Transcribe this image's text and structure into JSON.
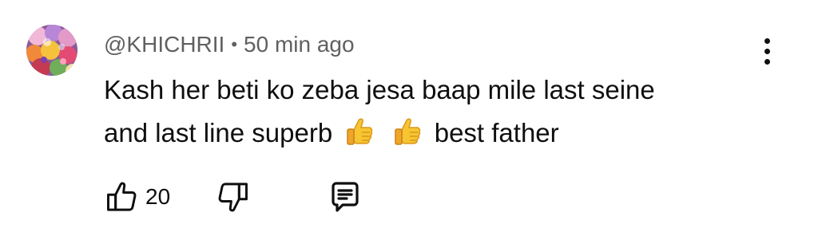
{
  "comment": {
    "author": "@KHICHRII",
    "separator": "•",
    "time": "50 min ago",
    "text_line1": "Kash her beti ko zeba jesa baap mile last seine",
    "text_line2_before": "and last line superb",
    "text_line2_after": "best father",
    "emoji_count": 2,
    "emoji_name": "thumbs-up"
  },
  "actions": {
    "like_count": "20",
    "icons": [
      "thumbs-up-outline-icon",
      "thumbs-down-outline-icon",
      "reply-comment-icon",
      "more-vertical-icon"
    ]
  },
  "colors": {
    "primary_text": "#0f0f0f",
    "secondary_text": "#606060",
    "background": "#ffffff"
  }
}
